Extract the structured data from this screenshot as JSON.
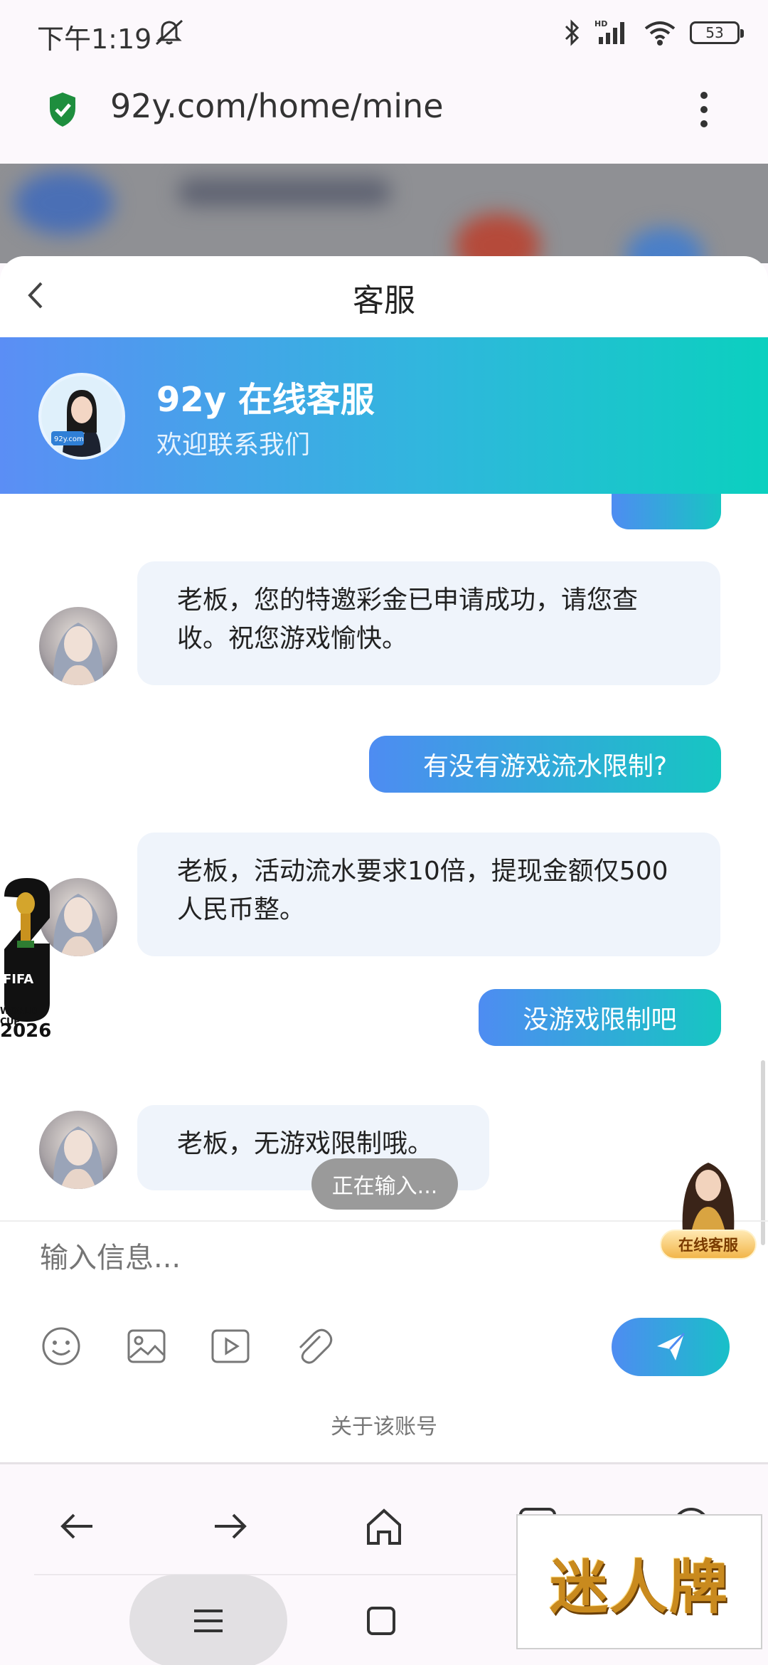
{
  "status_bar": {
    "time": "下午1:19",
    "battery": "53"
  },
  "browser": {
    "url": "92y.com/home/mine"
  },
  "sheet": {
    "title": "客服"
  },
  "agent": {
    "name": "92y 在线客服",
    "subtitle": "欢迎联系我们"
  },
  "messages": [
    {
      "from": "agent",
      "text": "老板，您的特邀彩金已申请成功，请您查收。祝您游戏愉快。"
    },
    {
      "from": "user",
      "text": "有没有游戏流水限制?"
    },
    {
      "from": "agent",
      "text": "老板，活动流水要求10倍，提现金额仅500人民币整。"
    },
    {
      "from": "user",
      "text": "没游戏限制吧"
    },
    {
      "from": "agent",
      "text": "老板，无游戏限制哦。"
    }
  ],
  "typing_indicator": "正在输入...",
  "composer": {
    "placeholder": "输入信息...",
    "about_link": "关于该账号"
  },
  "float_widget": {
    "label": "在线客服"
  },
  "sticker": {
    "fifa": "FIFA",
    "world_cup": "WORLD CUP",
    "year": "2026"
  },
  "watermark": "迷人牌",
  "icons": {
    "status": [
      "mute-icon",
      "bluetooth-icon",
      "signal-icon",
      "wifi-icon",
      "battery-icon"
    ],
    "tools": [
      "emoji-icon",
      "image-icon",
      "video-icon",
      "attachment-icon",
      "send-icon"
    ],
    "nav": [
      "back-arrow-icon",
      "forward-arrow-icon",
      "home-icon",
      "tabs-icon",
      "profile-icon"
    ]
  },
  "colors": {
    "accent_start": "#4e8cf2",
    "accent_end": "#16c6c2",
    "incoming_bubble": "#eff4fb"
  }
}
